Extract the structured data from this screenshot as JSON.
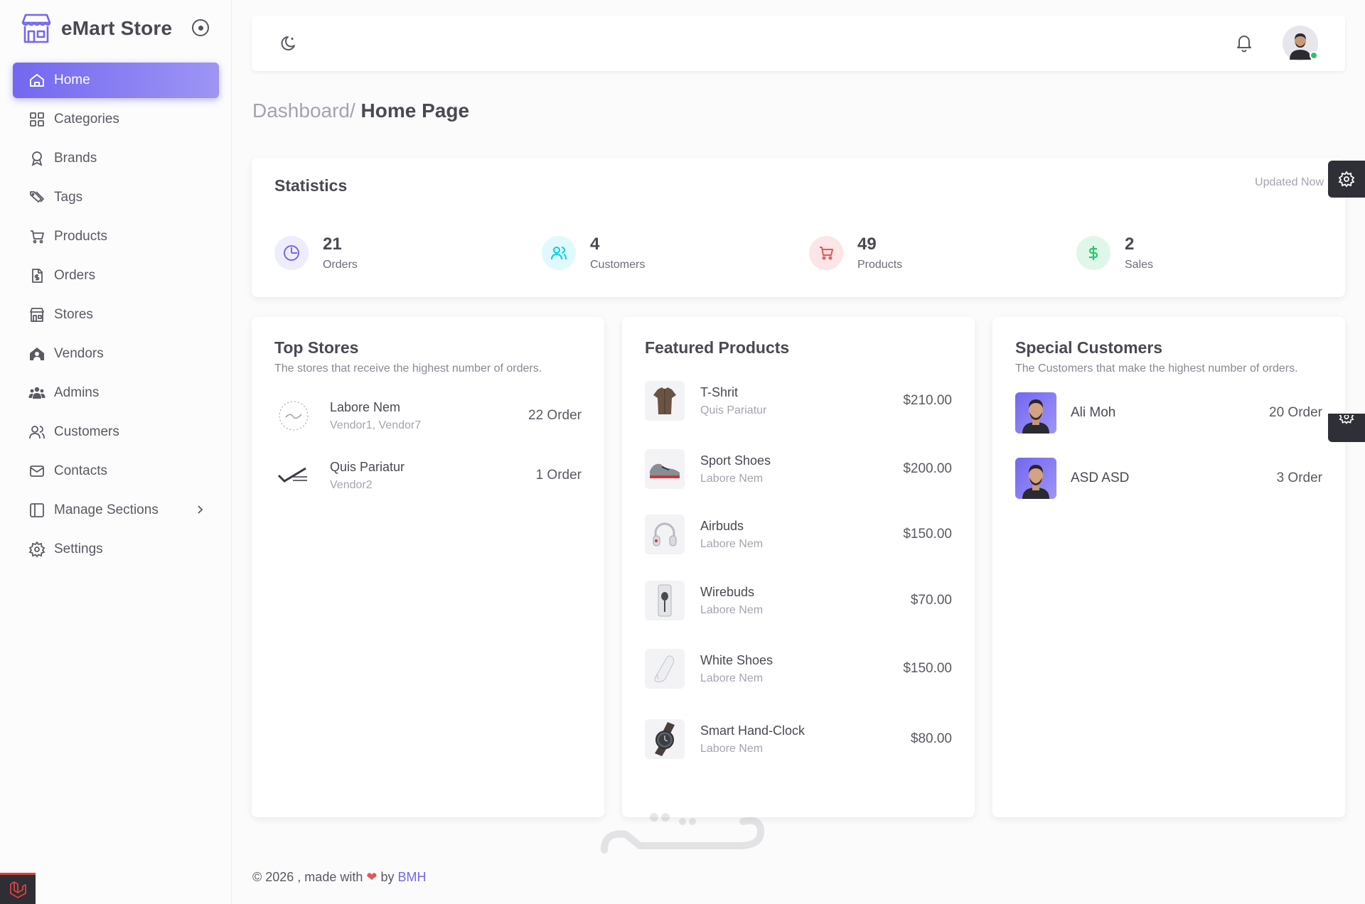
{
  "brand": {
    "name": "eMart Store"
  },
  "sidebar": {
    "items": [
      {
        "label": "Home",
        "icon": "home-icon",
        "active": true
      },
      {
        "label": "Categories",
        "icon": "grid-icon"
      },
      {
        "label": "Brands",
        "icon": "award-icon"
      },
      {
        "label": "Tags",
        "icon": "tags-icon"
      },
      {
        "label": "Products",
        "icon": "cart-icon"
      },
      {
        "label": "Orders",
        "icon": "invoice-icon"
      },
      {
        "label": "Stores",
        "icon": "store-icon"
      },
      {
        "label": "Vendors",
        "icon": "vendor-icon"
      },
      {
        "label": "Admins",
        "icon": "users-group-icon"
      },
      {
        "label": "Customers",
        "icon": "users-icon"
      },
      {
        "label": "Contacts",
        "icon": "mail-icon"
      },
      {
        "label": "Manage Sections",
        "icon": "layout-icon",
        "has_submenu": true
      },
      {
        "label": "Settings",
        "icon": "gear-icon"
      }
    ]
  },
  "breadcrumb": {
    "parent": "Dashboard/",
    "current": "Home Page"
  },
  "statistics": {
    "title": "Statistics",
    "updated": "Updated Now",
    "items": [
      {
        "value": "21",
        "label": "Orders",
        "color": "#7367f0",
        "bg": "#eeedfd"
      },
      {
        "value": "4",
        "label": "Customers",
        "color": "#00cfe8",
        "bg": "#e0f9fc"
      },
      {
        "value": "49",
        "label": "Products",
        "color": "#ea5455",
        "bg": "#fce5e6"
      },
      {
        "value": "2",
        "label": "Sales",
        "color": "#28c76f",
        "bg": "#dff7e9"
      }
    ]
  },
  "top_stores": {
    "title": "Top Stores",
    "subtitle": "The stores that receive the highest number of orders.",
    "rows": [
      {
        "name": "Labore Nem",
        "vendors": "Vendor1, Vendor7",
        "orders": "22 Order"
      },
      {
        "name": "Quis Pariatur",
        "vendors": "Vendor2",
        "orders": "1 Order"
      }
    ]
  },
  "featured_products": {
    "title": "Featured Products",
    "rows": [
      {
        "name": "T-Shrit",
        "store": "Quis Pariatur",
        "price": "$210.00"
      },
      {
        "name": "Sport Shoes",
        "store": "Labore Nem",
        "price": "$200.00"
      },
      {
        "name": "Airbuds",
        "store": "Labore Nem",
        "price": "$150.00"
      },
      {
        "name": "Wirebuds",
        "store": "Labore Nem",
        "price": "$70.00"
      },
      {
        "name": "White Shoes",
        "store": "Labore Nem",
        "price": "$150.00"
      },
      {
        "name": "Smart Hand-Clock",
        "store": "Labore Nem",
        "price": "$80.00"
      }
    ]
  },
  "special_customers": {
    "title": "Special Customers",
    "subtitle": "The Customers that make the highest number of orders.",
    "rows": [
      {
        "name": "Ali Moh",
        "orders": "20 Order"
      },
      {
        "name": "ASD ASD",
        "orders": "3 Order"
      }
    ]
  },
  "footer": {
    "prefix": "© 2026 , made with",
    "by": "by",
    "author": "BMH"
  },
  "colors": {
    "accent": "#7367f0",
    "online": "#28c76f"
  }
}
